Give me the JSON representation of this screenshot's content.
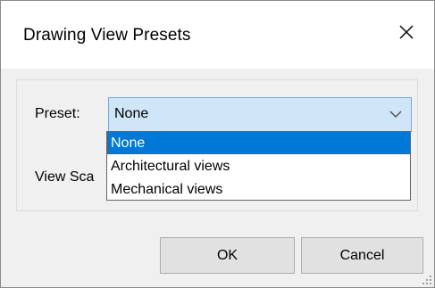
{
  "window": {
    "title": "Drawing View Presets"
  },
  "form": {
    "preset_label": "Preset:",
    "view_scale_label_visible": "View Sca",
    "preset_value": "None"
  },
  "dropdown": {
    "options": [
      {
        "label": "None",
        "selected": true
      },
      {
        "label": "Architectural views",
        "selected": false
      },
      {
        "label": "Mechanical views",
        "selected": false
      }
    ]
  },
  "buttons": {
    "ok_label": "OK",
    "cancel_label": "Cancel"
  },
  "icons": {
    "close": "close-icon",
    "combo_arrow": "chevron-down-icon",
    "resize_grip": "resize-grip-icon"
  },
  "colors": {
    "selection": "#0078d7",
    "combo_focus_bg": "#cfe5f8",
    "combo_focus_border": "#7aa8d6"
  }
}
